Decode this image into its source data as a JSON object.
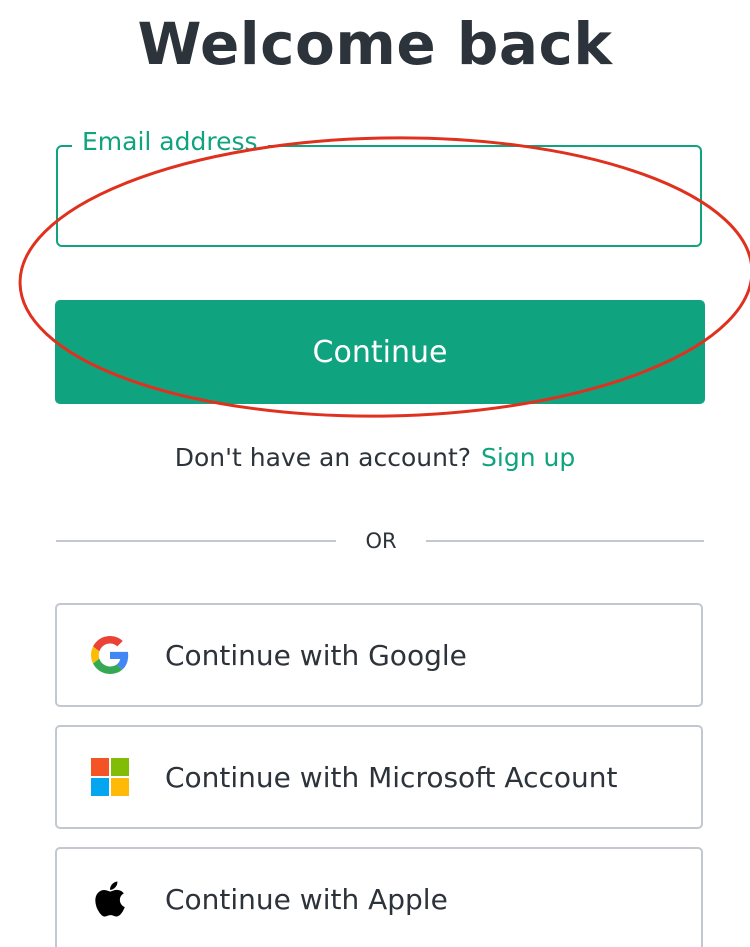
{
  "page": {
    "title": "Welcome back"
  },
  "email": {
    "label": "Email address",
    "value": "",
    "placeholder": ""
  },
  "continue_button": {
    "label": "Continue"
  },
  "signup": {
    "prompt": "Don't have an account?",
    "link_label": "Sign up"
  },
  "divider": {
    "text": "OR"
  },
  "social": {
    "google": {
      "label": "Continue with Google",
      "icon": "google-icon"
    },
    "microsoft": {
      "label": "Continue with Microsoft Account",
      "icon": "microsoft-icon"
    },
    "apple": {
      "label": "Continue with Apple",
      "icon": "apple-icon"
    }
  },
  "colors": {
    "accent": "#10a37f",
    "text": "#2d333a",
    "border": "#c2c8d0",
    "annotation": "#e0301e"
  }
}
